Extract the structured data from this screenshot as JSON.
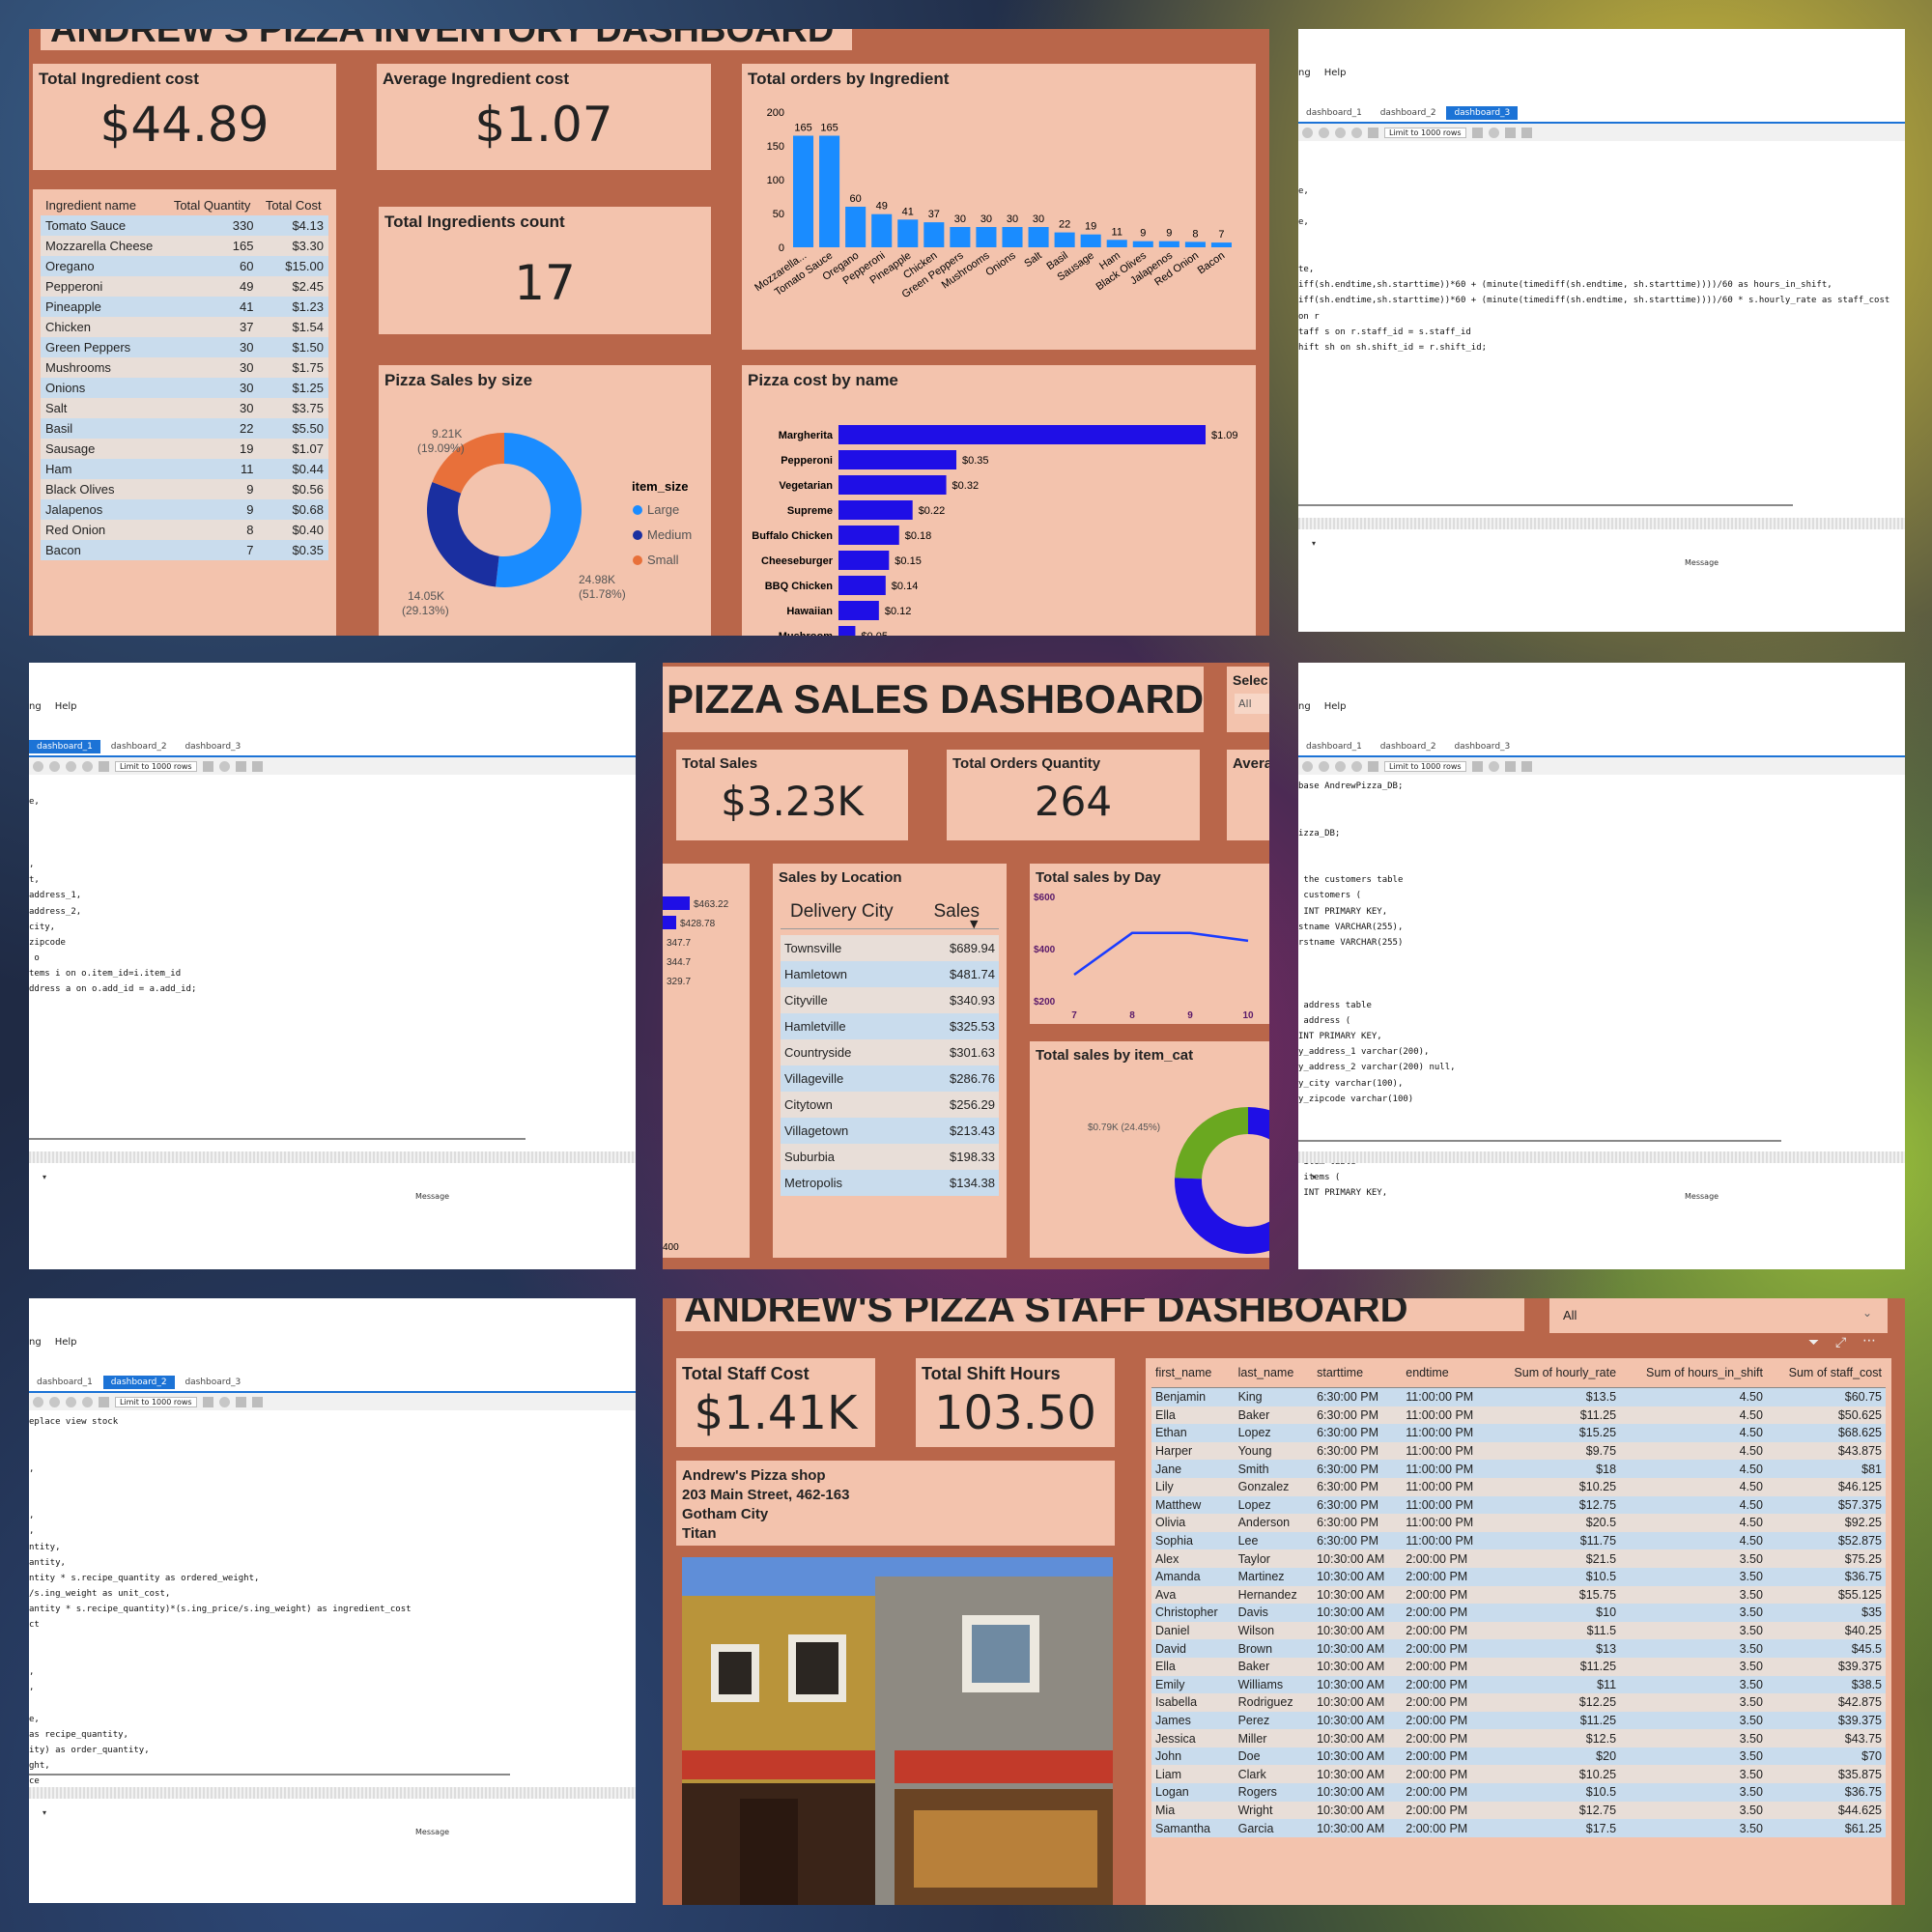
{
  "inventory": {
    "title": "ANDREW'S PIZZA INVENTORY DASHBOARD",
    "kpi1": {
      "label": "Total Ingredient cost",
      "value": "$44.89"
    },
    "kpi2": {
      "label": "Average Ingredient cost",
      "value": "$1.07"
    },
    "kpi3": {
      "label": "Total Ingredients count",
      "value": "17"
    },
    "table": {
      "headers": [
        "Ingredient name",
        "Total Quantity",
        "Total Cost"
      ],
      "rows": [
        [
          "Tomato Sauce",
          "330",
          "$4.13"
        ],
        [
          "Mozzarella Cheese",
          "165",
          "$3.30"
        ],
        [
          "Oregano",
          "60",
          "$15.00"
        ],
        [
          "Pepperoni",
          "49",
          "$2.45"
        ],
        [
          "Pineapple",
          "41",
          "$1.23"
        ],
        [
          "Chicken",
          "37",
          "$1.54"
        ],
        [
          "Green Peppers",
          "30",
          "$1.50"
        ],
        [
          "Mushrooms",
          "30",
          "$1.75"
        ],
        [
          "Onions",
          "30",
          "$1.25"
        ],
        [
          "Salt",
          "30",
          "$3.75"
        ],
        [
          "Basil",
          "22",
          "$5.50"
        ],
        [
          "Sausage",
          "19",
          "$1.07"
        ],
        [
          "Ham",
          "11",
          "$0.44"
        ],
        [
          "Black Olives",
          "9",
          "$0.56"
        ],
        [
          "Jalapenos",
          "9",
          "$0.68"
        ],
        [
          "Red Onion",
          "8",
          "$0.40"
        ],
        [
          "Bacon",
          "7",
          "$0.35"
        ]
      ]
    },
    "orders_title": "Total orders by Ingredient",
    "size_title": "Pizza Sales by size",
    "size_legend_title": "item_size",
    "size_labels": {
      "small": "9.21K",
      "small_pct": "(19.09%)",
      "medium": "14.05K",
      "medium_pct": "(29.13%)",
      "large": "24.98K",
      "large_pct": "(51.78%)"
    },
    "cost_title": "Pizza cost by name"
  },
  "sales": {
    "title": "PIZZA SALES DASHBOARD",
    "slicer_label": "Selec",
    "slicer_value": "All",
    "kpi1": {
      "label": "Total Sales",
      "value": "$3.23K"
    },
    "kpi2": {
      "label": "Total Orders Quantity",
      "value": "264"
    },
    "kpi3_label": "Avera",
    "partial_bars": [
      "$463.22",
      "$428.78",
      "347.7",
      "344.7",
      "329.7"
    ],
    "partial_axis": "400",
    "location_title": "Sales by Location",
    "location_headers": [
      "Delivery City",
      "Sales"
    ],
    "locations": [
      [
        "Townsville",
        "$689.94"
      ],
      [
        "Hamletown",
        "$481.74"
      ],
      [
        "Cityville",
        "$340.93"
      ],
      [
        "Hamletville",
        "$325.53"
      ],
      [
        "Countryside",
        "$301.63"
      ],
      [
        "Villageville",
        "$286.76"
      ],
      [
        "Citytown",
        "$256.29"
      ],
      [
        "Villagetown",
        "$213.43"
      ],
      [
        "Suburbia",
        "$198.33"
      ],
      [
        "Metropolis",
        "$134.38"
      ]
    ],
    "day_title": "Total sales by Day",
    "cat_title": "Total sales by item_cat",
    "cat_label": "$0.79K (24.45%)"
  },
  "staff": {
    "title": "ANDREW'S PIZZA STAFF DASHBOARD",
    "slicer_value": "All",
    "kpi1": {
      "label": "Total Staff Cost",
      "value": "$1.41K"
    },
    "kpi2": {
      "label": "Total Shift Hours",
      "value": "103.50"
    },
    "address": [
      "Andrew's Pizza shop",
      "203 Main Street, 462-163",
      "Gotham City",
      "Titan"
    ],
    "headers": [
      "first_name",
      "last_name",
      "starttime",
      "endtime",
      "Sum of hourly_rate",
      "Sum of hours_in_shift",
      "Sum of staff_cost"
    ],
    "rows": [
      [
        "Benjamin",
        "King",
        "6:30:00 PM",
        "11:00:00 PM",
        "$13.5",
        "4.50",
        "$60.75"
      ],
      [
        "Ella",
        "Baker",
        "6:30:00 PM",
        "11:00:00 PM",
        "$11.25",
        "4.50",
        "$50.625"
      ],
      [
        "Ethan",
        "Lopez",
        "6:30:00 PM",
        "11:00:00 PM",
        "$15.25",
        "4.50",
        "$68.625"
      ],
      [
        "Harper",
        "Young",
        "6:30:00 PM",
        "11:00:00 PM",
        "$9.75",
        "4.50",
        "$43.875"
      ],
      [
        "Jane",
        "Smith",
        "6:30:00 PM",
        "11:00:00 PM",
        "$18",
        "4.50",
        "$81"
      ],
      [
        "Lily",
        "Gonzalez",
        "6:30:00 PM",
        "11:00:00 PM",
        "$10.25",
        "4.50",
        "$46.125"
      ],
      [
        "Matthew",
        "Lopez",
        "6:30:00 PM",
        "11:00:00 PM",
        "$12.75",
        "4.50",
        "$57.375"
      ],
      [
        "Olivia",
        "Anderson",
        "6:30:00 PM",
        "11:00:00 PM",
        "$20.5",
        "4.50",
        "$92.25"
      ],
      [
        "Sophia",
        "Lee",
        "6:30:00 PM",
        "11:00:00 PM",
        "$11.75",
        "4.50",
        "$52.875"
      ],
      [
        "Alex",
        "Taylor",
        "10:30:00 AM",
        "2:00:00 PM",
        "$21.5",
        "3.50",
        "$75.25"
      ],
      [
        "Amanda",
        "Martinez",
        "10:30:00 AM",
        "2:00:00 PM",
        "$10.5",
        "3.50",
        "$36.75"
      ],
      [
        "Ava",
        "Hernandez",
        "10:30:00 AM",
        "2:00:00 PM",
        "$15.75",
        "3.50",
        "$55.125"
      ],
      [
        "Christopher",
        "Davis",
        "10:30:00 AM",
        "2:00:00 PM",
        "$10",
        "3.50",
        "$35"
      ],
      [
        "Daniel",
        "Wilson",
        "10:30:00 AM",
        "2:00:00 PM",
        "$11.5",
        "3.50",
        "$40.25"
      ],
      [
        "David",
        "Brown",
        "10:30:00 AM",
        "2:00:00 PM",
        "$13",
        "3.50",
        "$45.5"
      ],
      [
        "Ella",
        "Baker",
        "10:30:00 AM",
        "2:00:00 PM",
        "$11.25",
        "3.50",
        "$39.375"
      ],
      [
        "Emily",
        "Williams",
        "10:30:00 AM",
        "2:00:00 PM",
        "$11",
        "3.50",
        "$38.5"
      ],
      [
        "Isabella",
        "Rodriguez",
        "10:30:00 AM",
        "2:00:00 PM",
        "$12.25",
        "3.50",
        "$42.875"
      ],
      [
        "James",
        "Perez",
        "10:30:00 AM",
        "2:00:00 PM",
        "$11.25",
        "3.50",
        "$39.375"
      ],
      [
        "Jessica",
        "Miller",
        "10:30:00 AM",
        "2:00:00 PM",
        "$12.5",
        "3.50",
        "$43.75"
      ],
      [
        "John",
        "Doe",
        "10:30:00 AM",
        "2:00:00 PM",
        "$20",
        "3.50",
        "$70"
      ],
      [
        "Liam",
        "Clark",
        "10:30:00 AM",
        "2:00:00 PM",
        "$10.25",
        "3.50",
        "$35.875"
      ],
      [
        "Logan",
        "Rogers",
        "10:30:00 AM",
        "2:00:00 PM",
        "$10.5",
        "3.50",
        "$36.75"
      ],
      [
        "Mia",
        "Wright",
        "10:30:00 AM",
        "2:00:00 PM",
        "$12.75",
        "3.50",
        "$44.625"
      ],
      [
        "Samantha",
        "Garcia",
        "10:30:00 AM",
        "2:00:00 PM",
        "$17.5",
        "3.50",
        "$61.25"
      ]
    ]
  },
  "workbench": {
    "menu": [
      "ng",
      "Help"
    ],
    "tabs": [
      "dashboard_1",
      "dashboard_2",
      "dashboard_3"
    ],
    "limit": "Limit to 1000 rows",
    "message": "Message",
    "code1": [
      "e,",
      "",
      "e,",
      "",
      "",
      "te,",
      "iff(sh.endtime,sh.starttime))*60 + (minute(timediff(sh.endtime, sh.starttime))))/60 as hours_in_shift,",
      "iff(sh.endtime,sh.starttime))*60 + (minute(timediff(sh.endtime, sh.starttime))))/60 * s.hourly_rate as staff_cost",
      "on r",
      "taff s on r.staff_id = s.staff_id",
      "hift sh on sh.shift_id = r.shift_id;"
    ],
    "code2": [
      "",
      "e,",
      "",
      "",
      "",
      ",",
      "t,",
      "address_1,",
      "address_2,",
      "city,",
      "zipcode",
      " o",
      "tems i on o.item_id=i.item_id",
      "ddress a on o.add_id = a.add_id;"
    ],
    "code3": [
      "base AndrewPizza_DB;",
      "",
      "",
      "izza_DB;",
      "",
      "",
      " the customers table",
      " customers (",
      " INT PRIMARY KEY,",
      "stname VARCHAR(255),",
      "rstname VARCHAR(255)",
      "",
      "",
      "",
      " address table",
      " address (",
      "INT PRIMARY KEY,",
      "y_address_1 varchar(200),",
      "y_address_2 varchar(200) null,",
      "y_city varchar(100),",
      "y_zipcode varchar(100)",
      "",
      "",
      "",
      " item table",
      " items (",
      " INT PRIMARY KEY,"
    ],
    "code4": [
      "eplace view stock",
      "",
      "",
      ",",
      "",
      "",
      ",",
      ",",
      "ntity,",
      "antity,",
      "ntity * s.recipe_quantity as ordered_weight,",
      "/s.ing_weight as unit_cost,",
      "antity * s.recipe_quantity)*(s.ing_price/s.ing_weight) as ingredient_cost",
      "ct",
      "",
      "",
      ",",
      ",",
      "",
      "e,",
      "as recipe_quantity,",
      "ity) as order_quantity,",
      "ght,",
      "ce"
    ]
  },
  "colors": {
    "pbi_bg": "#b9664a",
    "card": "#f3c3ad",
    "blue": "#1a8cff",
    "navy": "#1a2fa0",
    "orange": "#e8703a",
    "indigo": "#1f0fe6",
    "green": "#6aa820"
  },
  "chart_data": [
    {
      "type": "bar",
      "title": "Total orders by Ingredient",
      "categories": [
        "Mozzarella...",
        "Tomato Sauce",
        "Oregano",
        "Pepperoni",
        "Pineapple",
        "Chicken",
        "Green Peppers",
        "Mushrooms",
        "Onions",
        "Salt",
        "Basil",
        "Sausage",
        "Ham",
        "Black Olives",
        "Jalapenos",
        "Red Onion",
        "Bacon"
      ],
      "values": [
        165,
        165,
        60,
        49,
        41,
        37,
        30,
        30,
        30,
        30,
        22,
        19,
        11,
        9,
        9,
        8,
        7
      ],
      "ylim": [
        0,
        200
      ],
      "yticks": [
        "0",
        "50",
        "100",
        "150",
        "200"
      ]
    },
    {
      "type": "pie",
      "title": "Pizza Sales by size",
      "categories": [
        "Large",
        "Medium",
        "Small"
      ],
      "values": [
        24.98,
        14.05,
        9.21
      ],
      "legend": "right"
    },
    {
      "type": "bar",
      "title": "Pizza cost by name",
      "orientation": "horizontal",
      "categories": [
        "Margherita",
        "Pepperoni",
        "Vegetarian",
        "Supreme",
        "Buffalo Chicken",
        "Cheeseburger",
        "BBQ Chicken",
        "Hawaiian",
        "Mushroom"
      ],
      "values": [
        1.09,
        0.35,
        0.32,
        0.22,
        0.18,
        0.15,
        0.14,
        0.12,
        0.05
      ],
      "labels": [
        "$1.09",
        "$0.35",
        "$0.32",
        "$0.22",
        "$0.18",
        "$0.15",
        "$0.14",
        "$0.12",
        "$0.05"
      ]
    },
    {
      "type": "line",
      "title": "Total sales by Day",
      "x": [
        "7",
        "8",
        "9",
        "10"
      ],
      "values": [
        300,
        460,
        460,
        430
      ],
      "yticks": [
        "$200",
        "$400",
        "$600"
      ]
    },
    {
      "type": "pie",
      "title": "Total sales by item_cat",
      "categories": [
        "Green",
        "Blue"
      ],
      "values": [
        24.45,
        75.55
      ]
    }
  ]
}
